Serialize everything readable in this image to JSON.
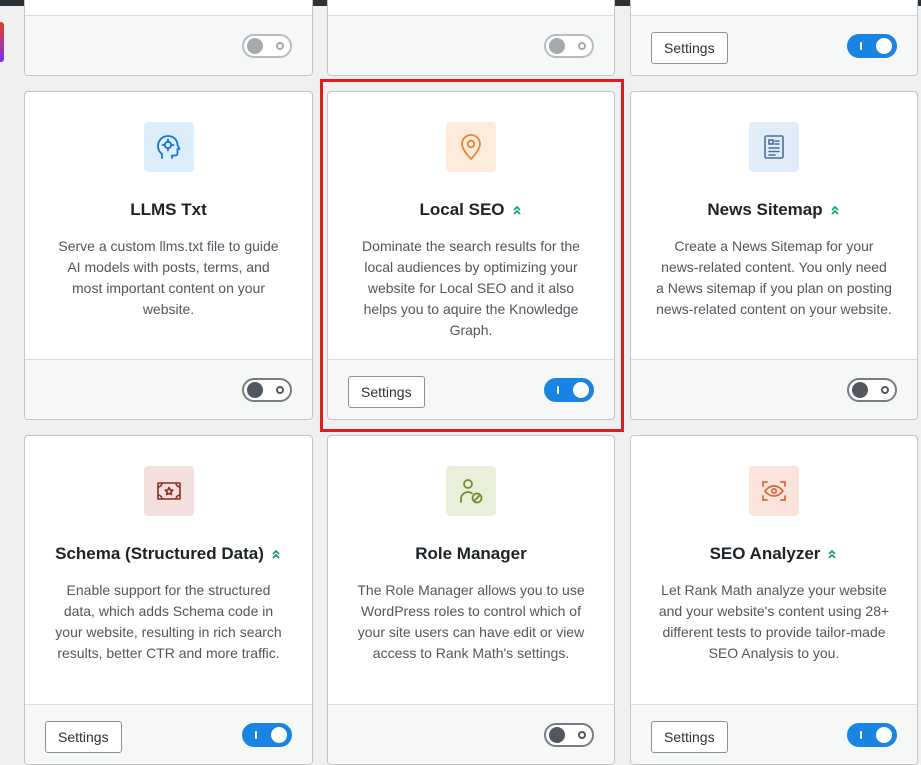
{
  "colors": {
    "accent_blue": "#1a84e2",
    "highlight_red": "#d9201e",
    "pro_green": "#1b9f6b"
  },
  "top_row": [
    {
      "settings_label": null,
      "toggle": "off-disabled"
    },
    {
      "settings_label": null,
      "toggle": "off-disabled"
    },
    {
      "settings_label": "Settings",
      "toggle": "on"
    }
  ],
  "modules": [
    {
      "title": "LLMS Txt",
      "pro": false,
      "icon": "ai-head-icon",
      "description": "Serve a custom llms.txt file to guide AI models with posts, terms, and most important content on your website.",
      "settings_label": null,
      "toggle": "off"
    },
    {
      "title": "Local SEO",
      "pro": true,
      "icon": "location-pin-icon",
      "description": "Dominate the search results for the local audiences by optimizing your website for Local SEO and it also helps you to aquire the Knowledge Graph.",
      "settings_label": "Settings",
      "toggle": "on"
    },
    {
      "title": "News Sitemap",
      "pro": true,
      "icon": "newspaper-icon",
      "description": "Create a News Sitemap for your news-related content. You only need a News sitemap if you plan on posting news-related content on your website.",
      "settings_label": null,
      "toggle": "off"
    },
    {
      "title": "Schema (Structured Data)",
      "pro": true,
      "icon": "certificate-icon",
      "description": "Enable support for the structured data, which adds Schema code in your website, resulting in rich search results, better CTR and more traffic.",
      "settings_label": "Settings",
      "toggle": "on"
    },
    {
      "title": "Role Manager",
      "pro": false,
      "icon": "user-block-icon",
      "description": "The Role Manager allows you to use WordPress roles to control which of your site users can have edit or view access to Rank Math's settings.",
      "settings_label": null,
      "toggle": "off"
    },
    {
      "title": "SEO Analyzer",
      "pro": true,
      "icon": "eye-scan-icon",
      "description": "Let Rank Math analyze your website and your website's content using 28+ different tests to provide tailor-made SEO Analysis to you.",
      "settings_label": "Settings",
      "toggle": "on"
    }
  ]
}
